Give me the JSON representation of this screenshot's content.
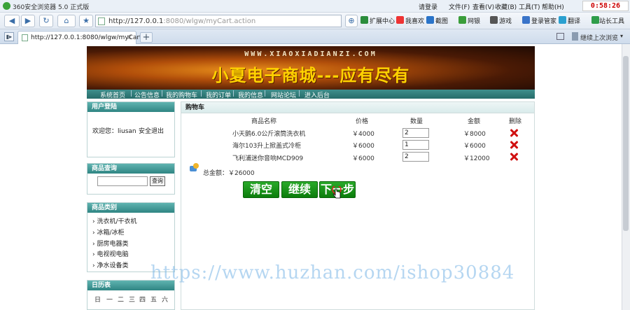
{
  "browser": {
    "title": "360安全浏览器 5.0 正式版",
    "menu": {
      "login": "请登录",
      "file": "文件(F)",
      "view": "查看(V)",
      "favorites": "收藏(B)",
      "tools": "工具(T)",
      "help": "帮助(H)"
    },
    "clock": "0:58:26",
    "url_main": "http://127.0.0.1",
    "url_rest": ":8080/wlgw/myCart.action",
    "toolbar": [
      "扩展中心",
      "我喜欢",
      "截图",
      "网银",
      "游戏",
      "登录管家",
      "翻译",
      "站长工具"
    ],
    "tab_title": "http://127.0.0.1:8080/wlgw/myCart...",
    "restore_text": "继续上次浏览",
    "colors": {
      "chrome": "#eaf0f7",
      "accent": "#3a6ea8",
      "clock": "#cc0000"
    }
  },
  "site": {
    "banner_domain": "WWW.XIAOXIADIANZI.COM",
    "banner_title": "小夏电子商城---应有尽有",
    "nav": [
      "系统首页",
      "公告信息",
      "我的购物车",
      "我的订单",
      "我的信息",
      "网站论坛",
      "进入后台"
    ],
    "user_panel": {
      "title": "用户登陆",
      "welcome": "欢迎您：liusan",
      "logout": "安全退出"
    },
    "search_panel": {
      "title": "商品查询",
      "button": "查询",
      "value": ""
    },
    "category_panel": {
      "title": "商品类别",
      "items": [
        "洗衣机/干衣机",
        "冰箱/冰柜",
        "厨房电器类",
        "电视视电脑",
        "净水设备类"
      ]
    },
    "calendar_panel": {
      "title": "日历表",
      "days": [
        "日",
        "一",
        "二",
        "三",
        "四",
        "五",
        "六"
      ]
    },
    "cart": {
      "title": "购物车",
      "headers": {
        "name": "商品名称",
        "price": "价格",
        "qty": "数量",
        "amount": "金额",
        "del": "删除"
      },
      "rows": [
        {
          "name": "小天鹅6.0公斤滚筒洗衣机",
          "price": "￥4000",
          "qty": "2",
          "amount": "￥8000"
        },
        {
          "name": "海尔103升上掀盖式冷柜",
          "price": "￥6000",
          "qty": "1",
          "amount": "￥6000"
        },
        {
          "name": "飞利浦迷你音响MCD909",
          "price": "￥6000",
          "qty": "2",
          "amount": "￥12000"
        }
      ],
      "total": "总金额：￥26000",
      "buttons": {
        "clear": "清空",
        "continue": "继续",
        "next": "下一步"
      }
    },
    "watermark": "https://www.huzhan.com/ishop30884",
    "colors": {
      "nav": "#2f7d7b",
      "button": "#149214",
      "delete": "#d01010",
      "banner_text": "#ffd200"
    }
  }
}
